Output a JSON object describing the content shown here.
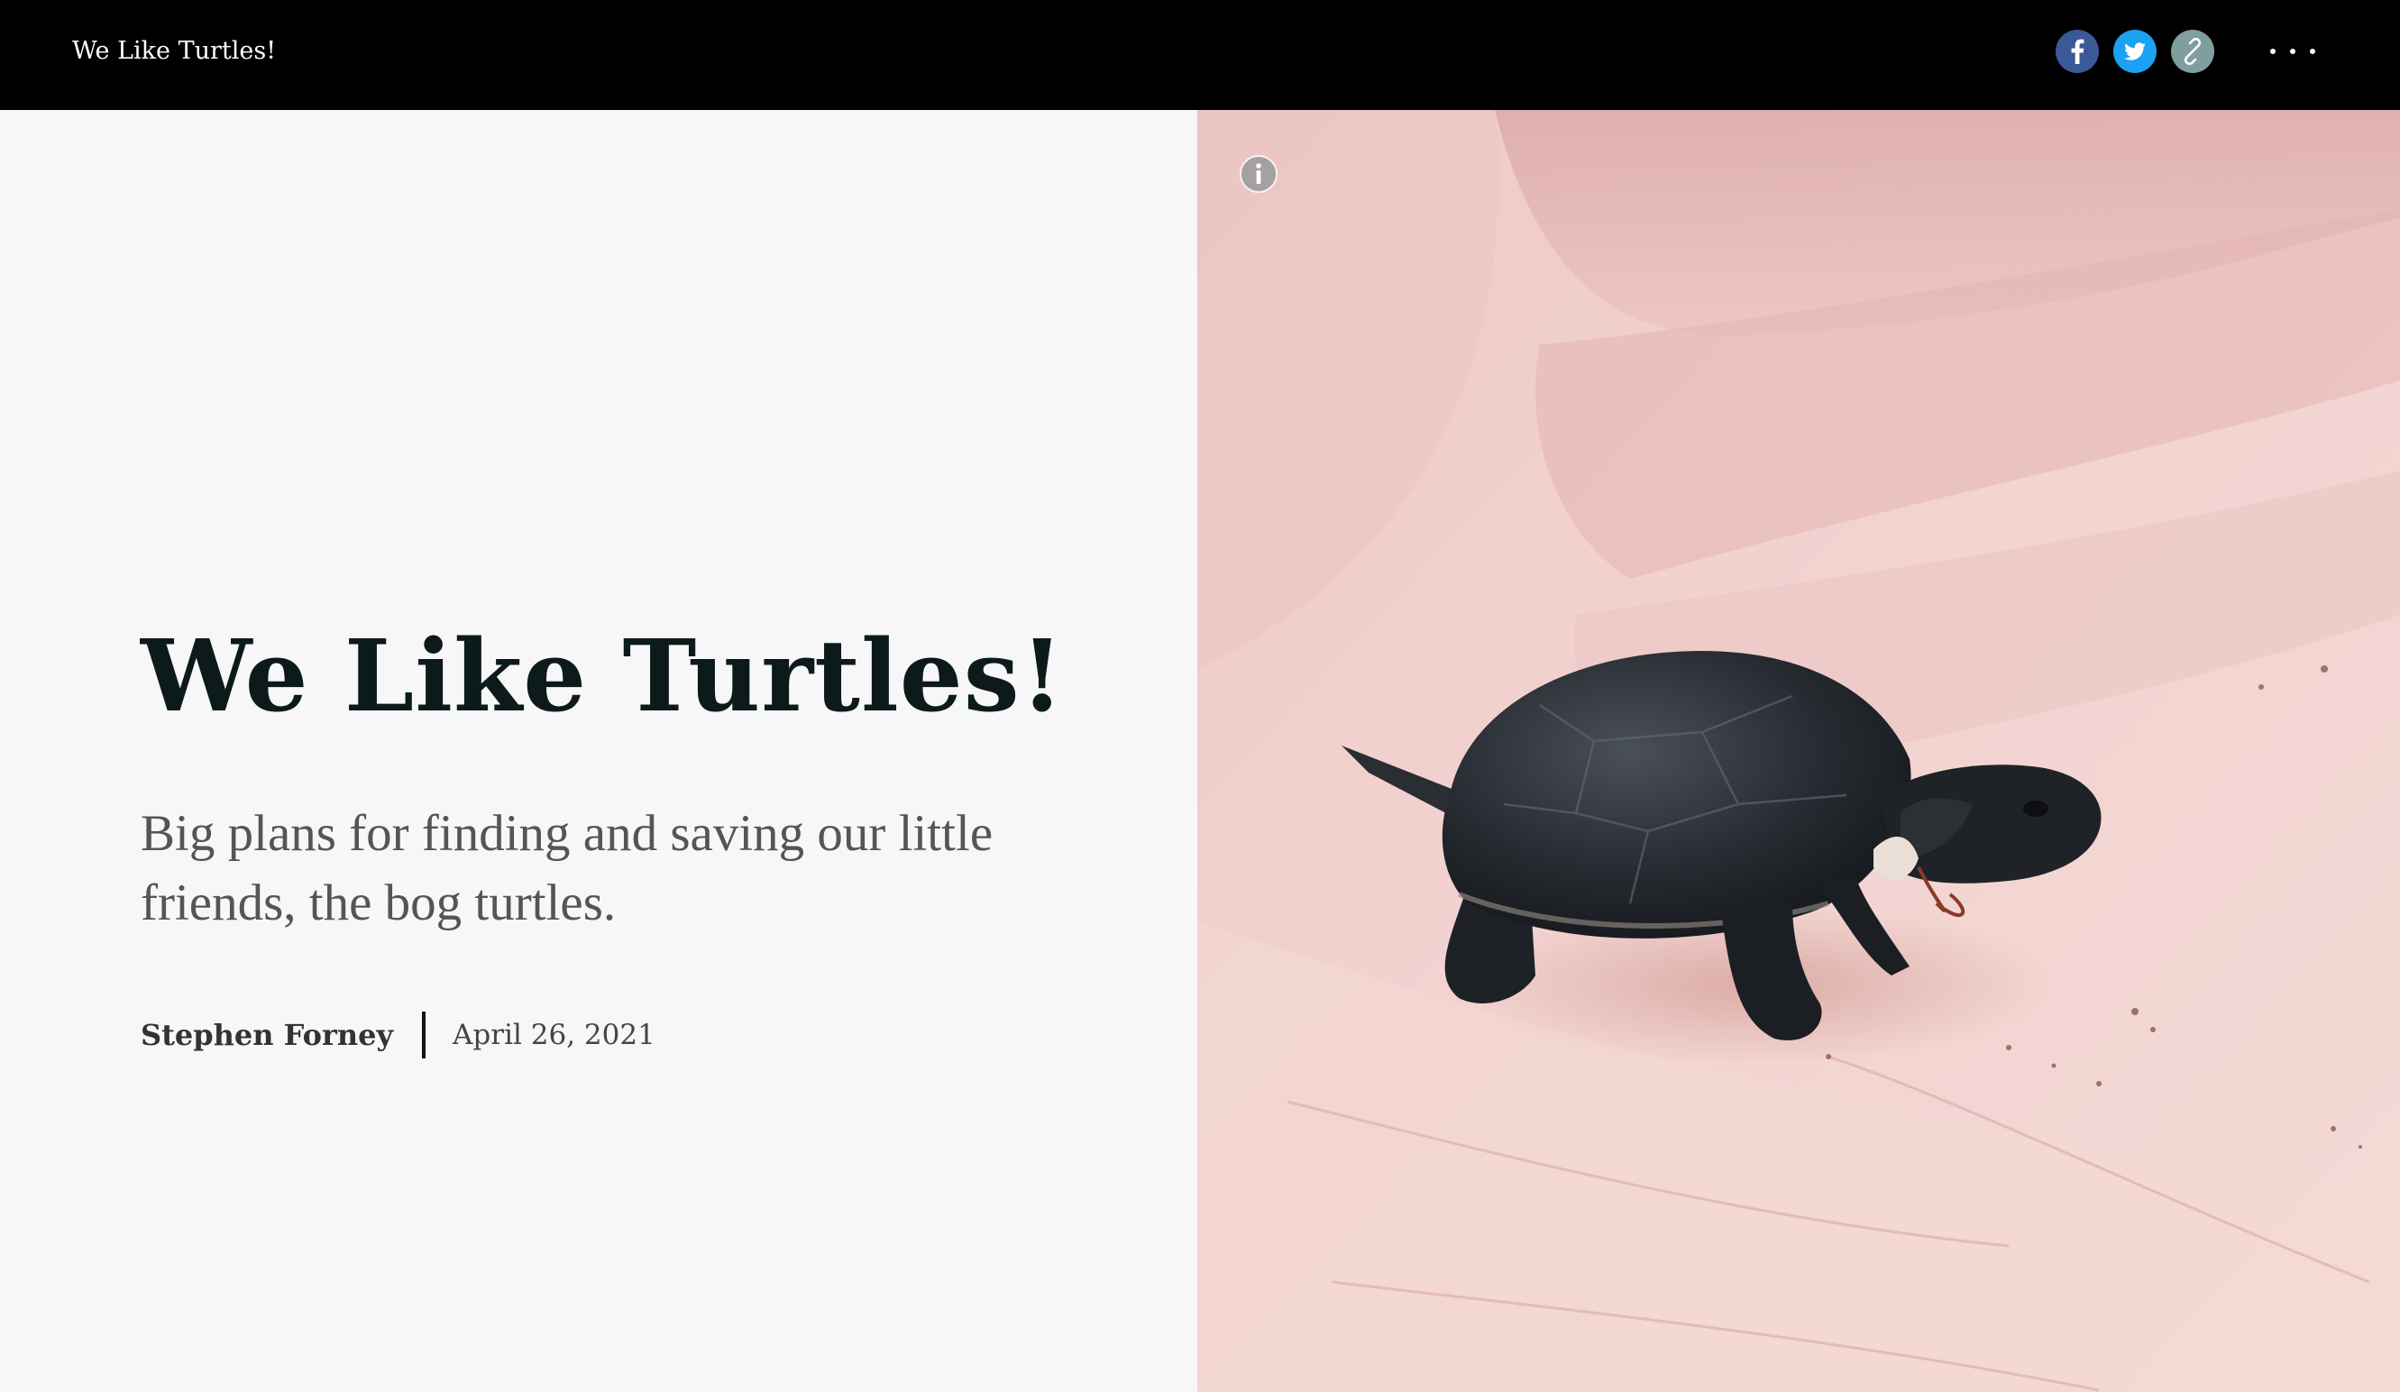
{
  "topbar": {
    "title": "We Like Turtles!",
    "share_icons": [
      "facebook-icon",
      "twitter-icon",
      "link-icon"
    ],
    "more_icon": "more-options-icon"
  },
  "cover": {
    "headline": "We Like Turtles!",
    "subtitle": "Big plans for finding and saving our little friends, the bog turtles.",
    "author": "Stephen Forney",
    "date": "April 26, 2021"
  },
  "hero_image": {
    "description_icon": "info-icon"
  },
  "colors": {
    "topbar_bg": "#000000",
    "page_bg": "#f7f7f7",
    "headline": "#0c1a1c",
    "facebook": "#3b5998",
    "twitter": "#1da1f2",
    "link": "#7f9f9f"
  }
}
